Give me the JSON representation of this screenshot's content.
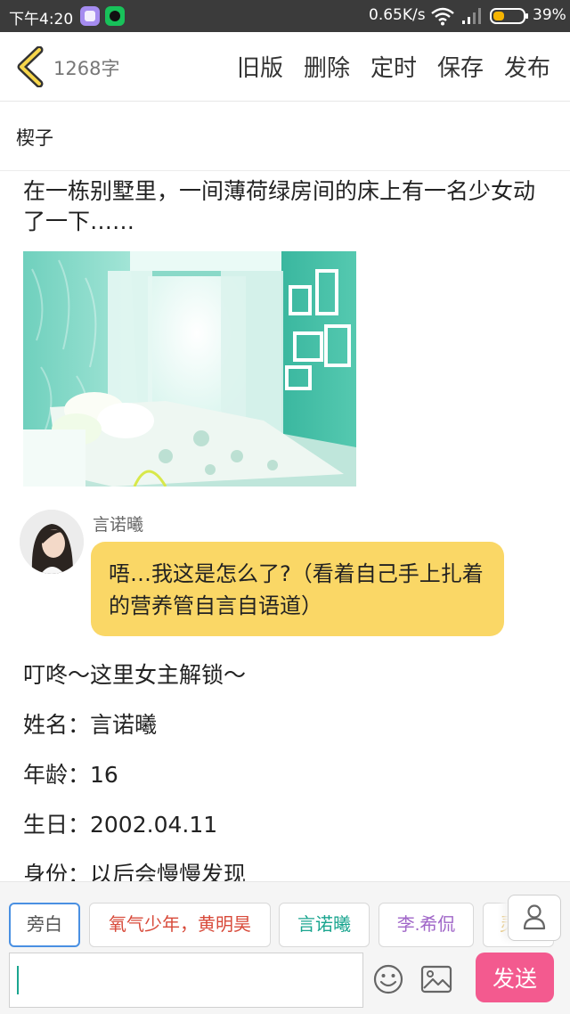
{
  "status": {
    "time": "下午4:20",
    "speed": "0.65K/s",
    "battery": "39%",
    "battery_level": 0.39
  },
  "toolbar": {
    "word_count": "1268字",
    "old_version": "旧版",
    "delete": "删除",
    "schedule": "定时",
    "save": "保存",
    "publish": "发布"
  },
  "title": "楔子",
  "content": {
    "intro": "在一栋别墅里，一间薄荷绿房间的床上有一名少女动了一下……",
    "dialogue": {
      "speaker": "言诺曦",
      "text": "唔…我这是怎么了?（看着自己手上扎着的营养管自言自语道）"
    },
    "paragraphs": [
      "叮咚～这里女主解锁～",
      "姓名：言诺曦",
      "年龄：16",
      "生日：2002.04.11",
      "身份：以后会慢慢发现"
    ]
  },
  "characters": [
    {
      "label": "旁白",
      "color": "#555555"
    },
    {
      "label": "氧气少年，黄明昊",
      "color": "#d84a3a"
    },
    {
      "label": "言诺曦",
      "color": "#1aa58f"
    },
    {
      "label": "李.希侃",
      "color": "#a066c8"
    },
    {
      "label": "灵",
      "color": "#d8a020"
    }
  ],
  "composer": {
    "input_value": "",
    "send": "发送"
  },
  "icons": {
    "back": "chevron-left-icon",
    "emoji": "smiley-icon",
    "image": "image-icon",
    "person": "person-icon"
  },
  "colors": {
    "bubble": "#fad766",
    "send": "#f35a8f",
    "active_chip_border": "#4a90e2"
  }
}
